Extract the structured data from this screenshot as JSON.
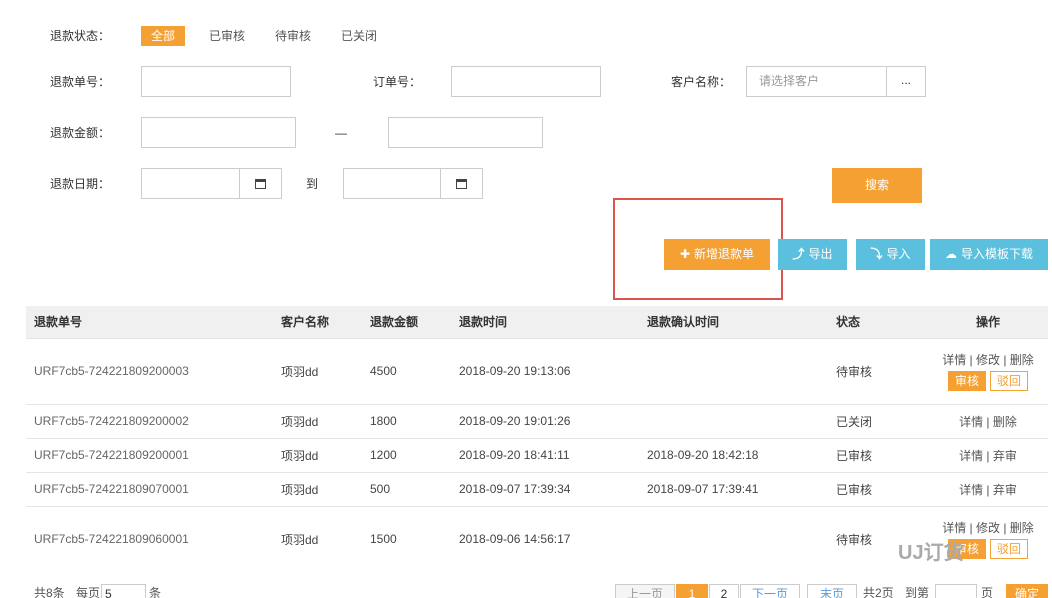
{
  "filters": {
    "status_label": "退款状态：",
    "status_tabs": [
      "全部",
      "已审核",
      "待审核",
      "已关闭"
    ],
    "refund_no_label": "退款单号：",
    "order_no_label": "订单号：",
    "customer_label": "客户名称：",
    "customer_placeholder": "请选择客户",
    "customer_btn": "...",
    "amount_label": "退款金额：",
    "range_sep": "—",
    "date_label": "退款日期：",
    "date_to": "到",
    "search_btn": "搜索"
  },
  "actions": {
    "add": "新增退款单",
    "export": "导出",
    "import": "导入",
    "template": "导入模板下载"
  },
  "table": {
    "headers": [
      "退款单号",
      "客户名称",
      "退款金额",
      "退款时间",
      "退款确认时间",
      "状态",
      "操作"
    ],
    "rows": [
      {
        "no": "URF7cb5-724221809200003",
        "customer": "项羽dd",
        "amount": "4500",
        "time": "2018-09-20 19:13:06",
        "confirm": "",
        "status": "待审核",
        "links": "详情 | 修改 | 删除",
        "b1": "审核",
        "b2": "驳回"
      },
      {
        "no": "URF7cb5-724221809200002",
        "customer": "项羽dd",
        "amount": "1800",
        "time": "2018-09-20 19:01:26",
        "confirm": "",
        "status": "已关闭",
        "links": "详情 | 删除"
      },
      {
        "no": "URF7cb5-724221809200001",
        "customer": "项羽dd",
        "amount": "1200",
        "time": "2018-09-20 18:41:11",
        "confirm": "2018-09-20 18:42:18",
        "status": "已审核",
        "links": "详情 | 弃审"
      },
      {
        "no": "URF7cb5-724221809070001",
        "customer": "项羽dd",
        "amount": "500",
        "time": "2018-09-07 17:39:34",
        "confirm": "2018-09-07 17:39:41",
        "status": "已审核",
        "links": "详情 | 弃审"
      },
      {
        "no": "URF7cb5-724221809060001",
        "customer": "项羽dd",
        "amount": "1500",
        "time": "2018-09-06 14:56:17",
        "confirm": "",
        "status": "待审核",
        "links": "详情 | 修改 | 删除",
        "b1": "审核",
        "b2": "驳回"
      }
    ]
  },
  "pager": {
    "total": "共8条",
    "per_page_label": "每页",
    "per_page_value": "5",
    "per_page_unit": "条",
    "prev": "上一页",
    "p1": "1",
    "p2": "2",
    "next": "下一页",
    "last": "末页",
    "pages": "共2页",
    "goto": "到第",
    "page_unit": "页",
    "confirm": "确定"
  },
  "watermark": "UJ订货"
}
